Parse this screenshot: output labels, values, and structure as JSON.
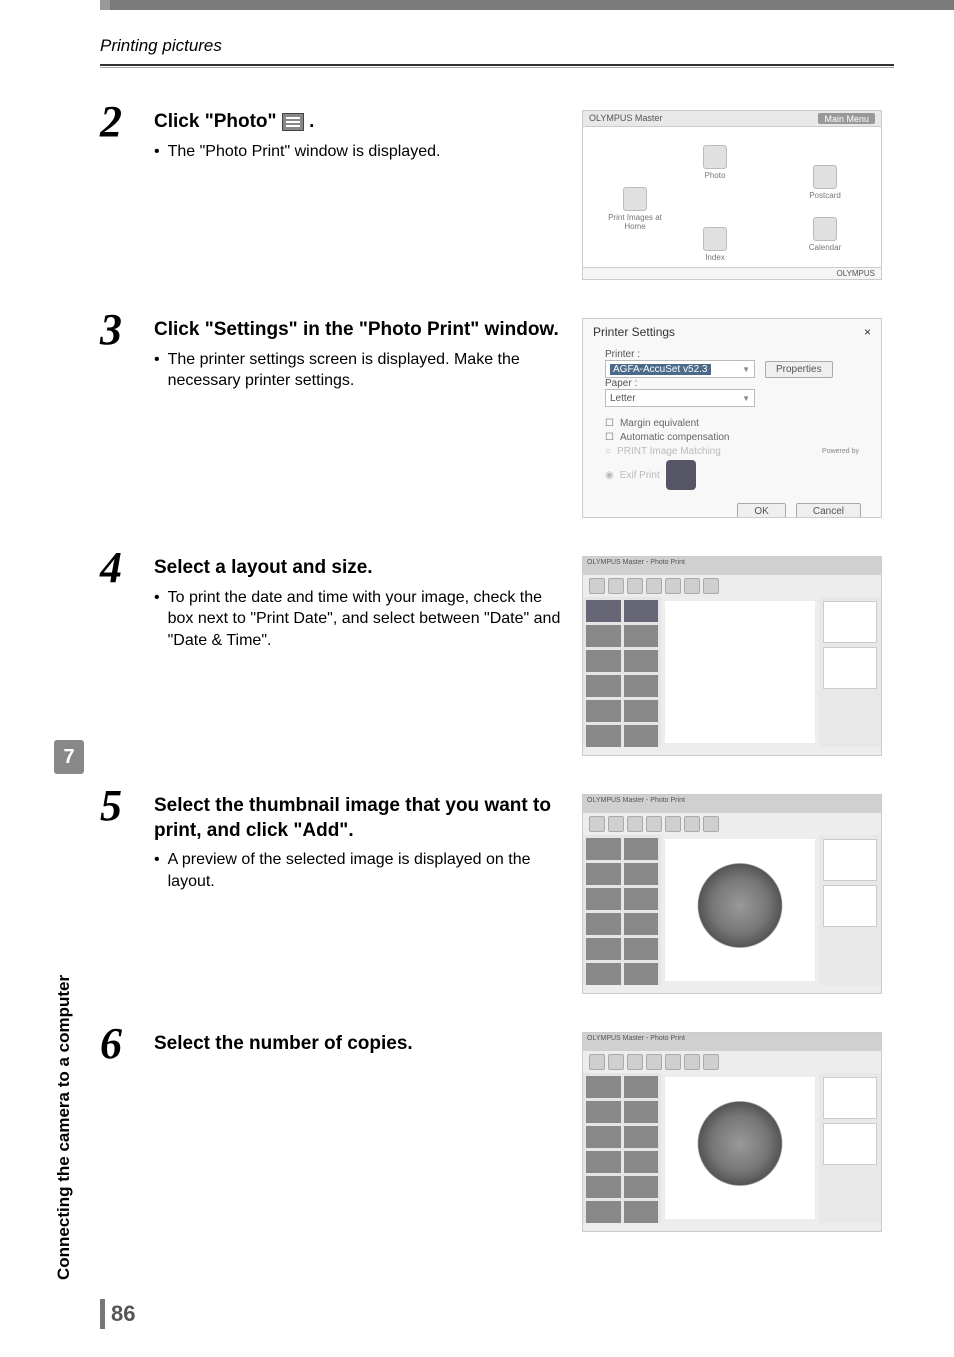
{
  "running_header": "Printing pictures",
  "chapter_number": "7",
  "side_tab_label": "Connecting the camera to a computer",
  "page_number": "86",
  "steps": {
    "s2": {
      "num": "2",
      "heading_pre": "Click \"Photo\" ",
      "heading_post": ".",
      "bullet": "The \"Photo Print\" window is displayed."
    },
    "s3": {
      "num": "3",
      "heading": "Click \"Settings\" in the \"Photo Print\" window.",
      "bullet": "The printer settings screen is displayed. Make the necessary printer settings."
    },
    "s4": {
      "num": "4",
      "heading": "Select a layout and size.",
      "bullet": "To print the date and time with your image, check the box next to \"Print Date\", and select between \"Date\" and \"Date & Time\"."
    },
    "s5": {
      "num": "5",
      "heading": "Select the thumbnail image that you want to print, and click \"Add\".",
      "bullet": "A preview of the selected image is displayed on the layout."
    },
    "s6": {
      "num": "6",
      "heading": "Select the number of copies."
    }
  },
  "screenshots": {
    "print_menu": {
      "title_left": "OLYMPUS Master",
      "title_right": "Main Menu",
      "items": {
        "photo": "Photo",
        "print_images": "Print Images at Home",
        "index": "Index",
        "postcard": "Postcard",
        "calendar": "Calendar"
      },
      "brand": "OLYMPUS"
    },
    "printer_settings": {
      "title": "Printer Settings",
      "close": "×",
      "printer_label": "Printer :",
      "printer_value": "AGFA-AccuSet v52.3",
      "properties": "Properties",
      "paper_label": "Paper :",
      "paper_value": "Letter",
      "margin": "Margin equivalent",
      "auto_comp": "Automatic compensation",
      "pim": "PRINT Image Matching",
      "exif": "Exif Print",
      "powered": "Powered by",
      "ok": "OK",
      "cancel": "Cancel"
    },
    "layout_window_title": "OLYMPUS Master - Photo Print"
  }
}
